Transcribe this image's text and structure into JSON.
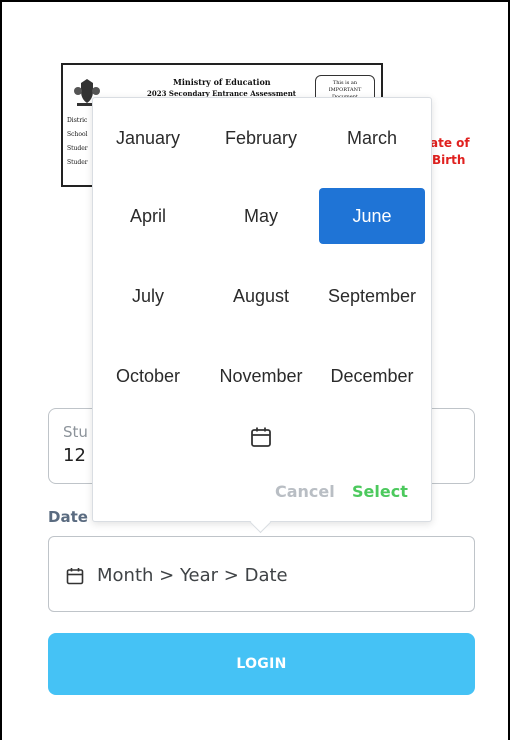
{
  "certificate": {
    "ministry": "Ministry of Education",
    "assessment": "2023 Secondary Entrance Assessment",
    "badge": "This is an IMPORTANT Document",
    "rows": [
      "Distric",
      "School",
      "Studer",
      "Studer"
    ]
  },
  "dob_hint": {
    "line1": "ate of",
    "line2": "Birth"
  },
  "student_field": {
    "label": "Stu",
    "value": "12"
  },
  "date_field": {
    "label": "Date",
    "placeholder": "Month > Year > Date"
  },
  "login": {
    "label": "LOGIN"
  },
  "picker": {
    "months": [
      "January",
      "February",
      "March",
      "April",
      "May",
      "June",
      "July",
      "August",
      "September",
      "October",
      "November",
      "December"
    ],
    "selected": "June",
    "cancel_label": "Cancel",
    "select_label": "Select"
  },
  "colors": {
    "selected_bg": "#1f74d6",
    "select_text": "#4cc95d",
    "cancel_text": "#b9bec4",
    "login_bg": "#45c2f5",
    "dob_hint": "#e0211f"
  }
}
